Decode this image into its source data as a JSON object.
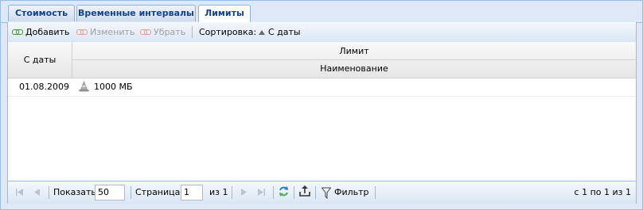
{
  "tabs": [
    {
      "label": "Стоимость"
    },
    {
      "label": "Временные интервалы"
    },
    {
      "label": "Лимиты"
    }
  ],
  "toolbar": {
    "add_label": "Добавить",
    "edit_label": "Изменить",
    "remove_label": "Убрать",
    "sort_label": "Сортировка:",
    "sort_field": "С даты"
  },
  "grid": {
    "col_date": "С даты",
    "col_limit": "Лимит",
    "col_name": "Наименование",
    "rows": [
      {
        "date": "01.08.2009",
        "name": "1000 МБ"
      }
    ]
  },
  "pager": {
    "show_label": "Показать",
    "page_size": "50",
    "page_label": "Страница",
    "page_value": "1",
    "of_label": "из 1",
    "filter_label": "Фильтр",
    "summary": "с 1 по 1 из 1"
  },
  "colors": {
    "accent": "#15428b",
    "border": "#99bbe8",
    "panel_bg": "#dfe8f6",
    "link_green": "#3c9a3c",
    "link_disabled": "#e0a090"
  }
}
